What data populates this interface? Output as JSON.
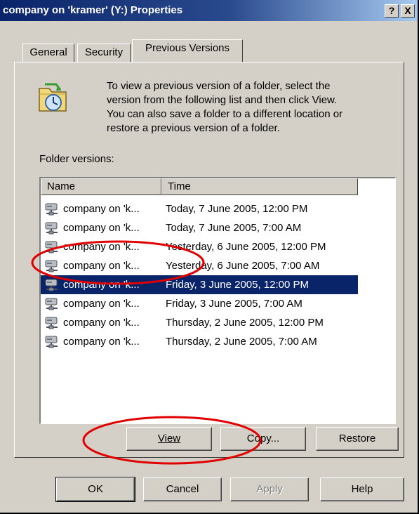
{
  "window": {
    "title": "company on 'kramer' (Y:) Properties",
    "help_button": "?",
    "close_button": "X"
  },
  "tabs": [
    {
      "label": "General",
      "active": false
    },
    {
      "label": "Security",
      "active": false
    },
    {
      "label": "Previous Versions",
      "active": true
    }
  ],
  "description": [
    "To view a previous version of a folder, select the",
    "version from the following list and then click View.",
    "You can also save a folder to a different location or",
    "restore a previous version of a folder."
  ],
  "folder_versions_label": "Folder versions:",
  "list": {
    "headers": {
      "name": "Name",
      "time": "Time"
    },
    "rows": [
      {
        "name": "company on 'k...",
        "time": "Today, 7 June 2005, 12:00 PM",
        "selected": false
      },
      {
        "name": "company on 'k...",
        "time": "Today, 7 June 2005, 7:00 AM",
        "selected": false
      },
      {
        "name": "company on 'k...",
        "time": "Yesterday, 6 June 2005, 12:00 PM",
        "selected": false
      },
      {
        "name": "company on 'k...",
        "time": "Yesterday, 6 June 2005, 7:00 AM",
        "selected": false
      },
      {
        "name": "company on 'k...",
        "time": "Friday, 3 June 2005, 12:00 PM",
        "selected": true
      },
      {
        "name": "company on 'k...",
        "time": "Friday, 3 June 2005, 7:00 AM",
        "selected": false
      },
      {
        "name": "company on 'k...",
        "time": "Thursday, 2 June 2005, 12:00 PM",
        "selected": false
      },
      {
        "name": "company on 'k...",
        "time": "Thursday, 2 June 2005, 7:00 AM",
        "selected": false
      }
    ]
  },
  "action_buttons": {
    "view": "View",
    "copy": "Copy...",
    "restore": "Restore"
  },
  "dialog_buttons": {
    "ok": "OK",
    "cancel": "Cancel",
    "apply": "Apply",
    "help": "Help"
  },
  "colors": {
    "titlebar": "#0a246a",
    "face": "#d4d0c8",
    "selection": "#0a246a",
    "highlight_circle": "#e00000"
  }
}
